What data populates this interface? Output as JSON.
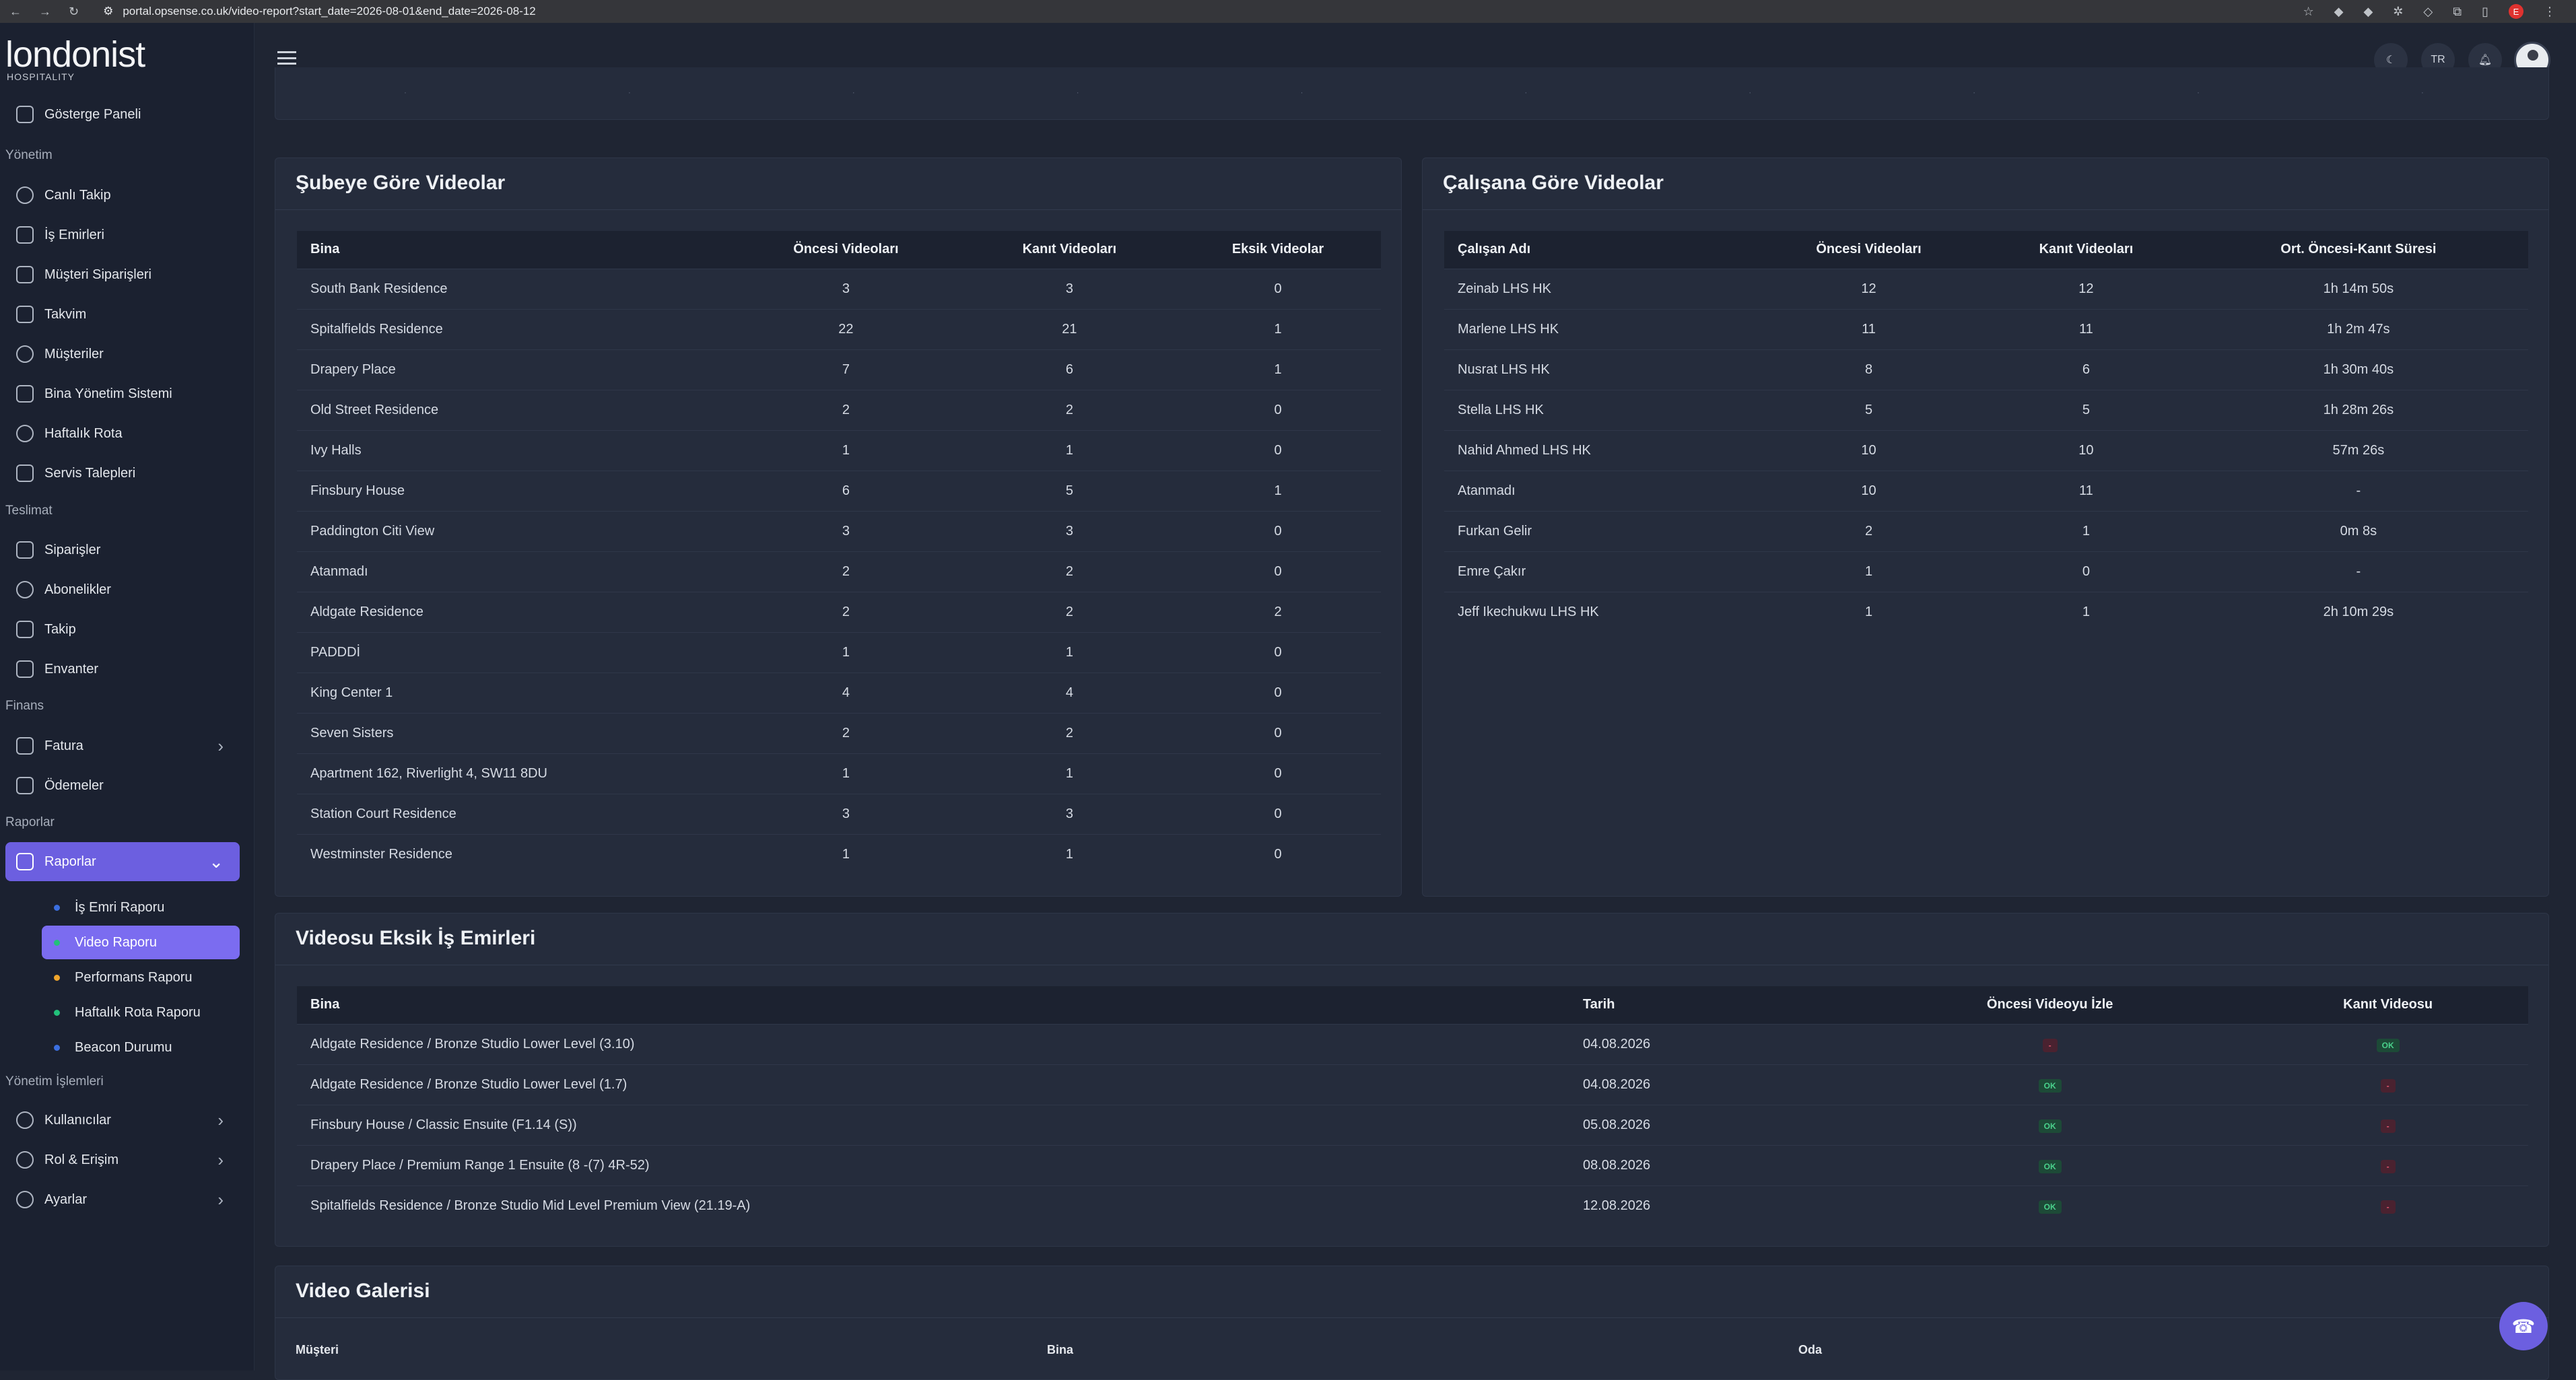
{
  "browser": {
    "url": "portal.opsense.co.uk/video-report?start_date=2026-08-01&end_date=2026-08-12",
    "profile_initial": "E"
  },
  "logo": {
    "name": "londonist",
    "sub": "HOSPITALITY"
  },
  "sidebar": {
    "dashboard": "Gösterge Paneli",
    "sections": {
      "management": "Yönetim",
      "delivery": "Teslimat",
      "finance": "Finans",
      "reports": "Raporlar",
      "admin": "Yönetim İşlemleri"
    },
    "items": {
      "live": "Canlı Takip",
      "work_orders": "İş Emirleri",
      "customer_orders": "Müşteri Siparişleri",
      "calendar": "Takvim",
      "customers": "Müşteriler",
      "bms": "Bina Yönetim Sistemi",
      "weekly_route": "Haftalık Rota",
      "service_requests": "Servis Talepleri",
      "orders": "Siparişler",
      "subscriptions": "Abonelikler",
      "tracking": "Takip",
      "inventory": "Envanter",
      "invoice": "Fatura",
      "payments": "Ödemeler",
      "reports": "Raporlar",
      "users": "Kullanıcılar",
      "roles": "Rol & Erişim",
      "settings": "Ayarlar"
    },
    "report_subitems": [
      "İş Emri Raporu",
      "Video Raporu",
      "Performans Raporu",
      "Haftalık Rota Raporu",
      "Beacon Durumu"
    ]
  },
  "topbar": {
    "lang": "TR"
  },
  "colors": {
    "accent": "#6c5fe0",
    "ok": "#4ad18c",
    "missing": "#e0566f"
  },
  "branch_card": {
    "title": "Şubeye Göre Videolar",
    "headers": [
      "Bina",
      "Öncesi Videoları",
      "Kanıt Videoları",
      "Eksik Videolar"
    ],
    "rows": [
      [
        "South Bank Residence",
        "3",
        "3",
        "0"
      ],
      [
        "Spitalfields Residence",
        "22",
        "21",
        "1"
      ],
      [
        "Drapery Place",
        "7",
        "6",
        "1"
      ],
      [
        "Old Street Residence",
        "2",
        "2",
        "0"
      ],
      [
        "Ivy Halls",
        "1",
        "1",
        "0"
      ],
      [
        "Finsbury House",
        "6",
        "5",
        "1"
      ],
      [
        "Paddington Citi View",
        "3",
        "3",
        "0"
      ],
      [
        "Atanmadı",
        "2",
        "2",
        "0"
      ],
      [
        "Aldgate Residence",
        "2",
        "2",
        "2"
      ],
      [
        "PADDDİ",
        "1",
        "1",
        "0"
      ],
      [
        "King Center 1",
        "4",
        "4",
        "0"
      ],
      [
        "Seven Sisters",
        "2",
        "2",
        "0"
      ],
      [
        "Apartment 162, Riverlight 4, SW11 8DU",
        "1",
        "1",
        "0"
      ],
      [
        "Station Court Residence",
        "3",
        "3",
        "0"
      ],
      [
        "Westminster Residence",
        "1",
        "1",
        "0"
      ]
    ]
  },
  "employee_card": {
    "title": "Çalışana Göre Videolar",
    "headers": [
      "Çalışan Adı",
      "Öncesi Videoları",
      "Kanıt Videoları",
      "Ort. Öncesi-Kanıt Süresi"
    ],
    "rows": [
      [
        "Zeinab LHS HK",
        "12",
        "12",
        "1h 14m 50s"
      ],
      [
        "Marlene LHS HK",
        "11",
        "11",
        "1h 2m 47s"
      ],
      [
        "Nusrat LHS HK",
        "8",
        "6",
        "1h 30m 40s"
      ],
      [
        "Stella LHS HK",
        "5",
        "5",
        "1h 28m 26s"
      ],
      [
        "Nahid Ahmed LHS HK",
        "10",
        "10",
        "57m 26s"
      ],
      [
        "Atanmadı",
        "10",
        "11",
        "-"
      ],
      [
        "Furkan Gelir",
        "2",
        "1",
        "0m 8s"
      ],
      [
        "Emre Çakır",
        "1",
        "0",
        "-"
      ],
      [
        "Jeff Ikechukwu LHS HK",
        "1",
        "1",
        "2h 10m 29s"
      ]
    ]
  },
  "missing_card": {
    "title": "Videosu Eksik İş Emirleri",
    "headers": [
      "Bina",
      "Tarih",
      "Öncesi Videoyu İzle",
      "Kanıt Videosu"
    ],
    "ok_label": "OK",
    "missing_label": "-",
    "rows": [
      {
        "bina": "Aldgate Residence / Bronze Studio Lower Level (3.10)",
        "tarih": "04.08.2026",
        "before": "-",
        "proof": "OK"
      },
      {
        "bina": "Aldgate Residence / Bronze Studio Lower Level (1.7)",
        "tarih": "04.08.2026",
        "before": "OK",
        "proof": "-"
      },
      {
        "bina": "Finsbury House / Classic Ensuite (F1.14 (S))",
        "tarih": "05.08.2026",
        "before": "OK",
        "proof": "-"
      },
      {
        "bina": "Drapery Place / Premium Range 1 Ensuite (8 -(7) 4R-52)",
        "tarih": "08.08.2026",
        "before": "OK",
        "proof": "-"
      },
      {
        "bina": "Spitalfields Residence / Bronze Studio Mid Level Premium View (21.19-A)",
        "tarih": "12.08.2026",
        "before": "OK",
        "proof": "-"
      }
    ]
  },
  "gallery": {
    "title": "Video Galerisi",
    "filters": [
      "Müşteri",
      "Bina",
      "Oda"
    ]
  }
}
